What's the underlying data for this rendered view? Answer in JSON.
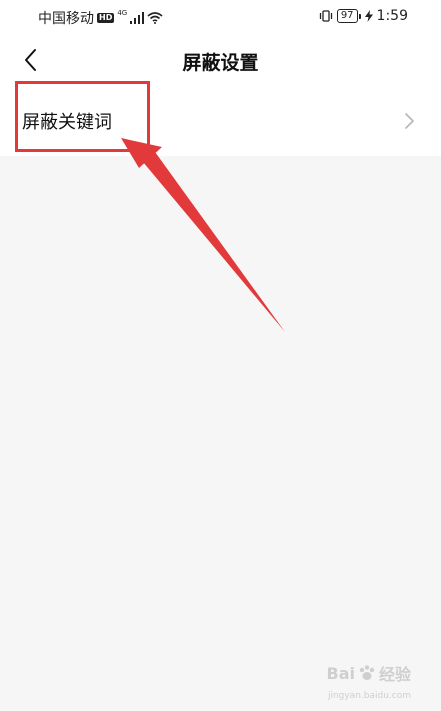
{
  "status_bar": {
    "carrier": "中国移动",
    "hd_badge": "HD",
    "network": "4G",
    "battery_level": "97",
    "time": "1:59"
  },
  "header": {
    "title": "屏蔽设置",
    "back_icon": "chevron-left-icon"
  },
  "settings": {
    "items": [
      {
        "label": "屏蔽关键词",
        "icon": "chevron-right-icon"
      }
    ]
  },
  "annotation": {
    "color": "#e23a3a"
  },
  "watermark": {
    "brand": "Bai",
    "brand_suffix": "经验",
    "site": "jingyan.baidu.com"
  }
}
